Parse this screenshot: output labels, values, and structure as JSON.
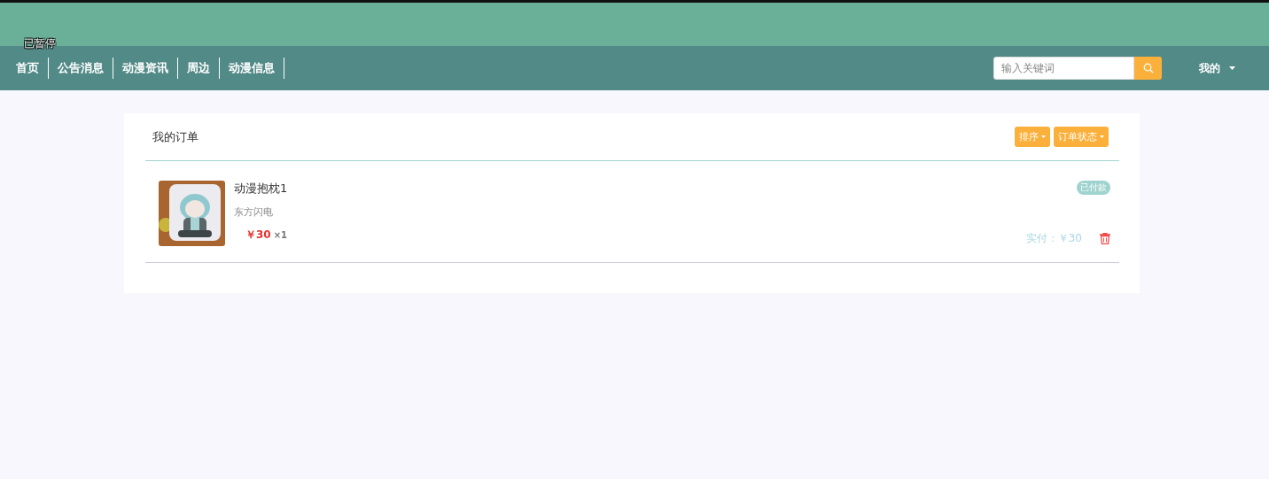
{
  "overlay": {
    "label": "已暂停"
  },
  "nav": {
    "items": [
      {
        "label": "首页"
      },
      {
        "label": "公告消息"
      },
      {
        "label": "动漫资讯"
      },
      {
        "label": "周边"
      },
      {
        "label": "动漫信息"
      }
    ],
    "search": {
      "placeholder": "输入关键词"
    },
    "user_menu": {
      "label": "我的"
    }
  },
  "orders_panel": {
    "title": "我的订单",
    "buttons": [
      {
        "label": "排序"
      },
      {
        "label": "订单状态"
      }
    ],
    "orders": [
      {
        "name": "动漫抱枕1",
        "shop": "东方闪电",
        "price": "￥30",
        "quantity": "×1",
        "status": "已付款",
        "paid_total": "实付：￥30"
      }
    ]
  }
}
